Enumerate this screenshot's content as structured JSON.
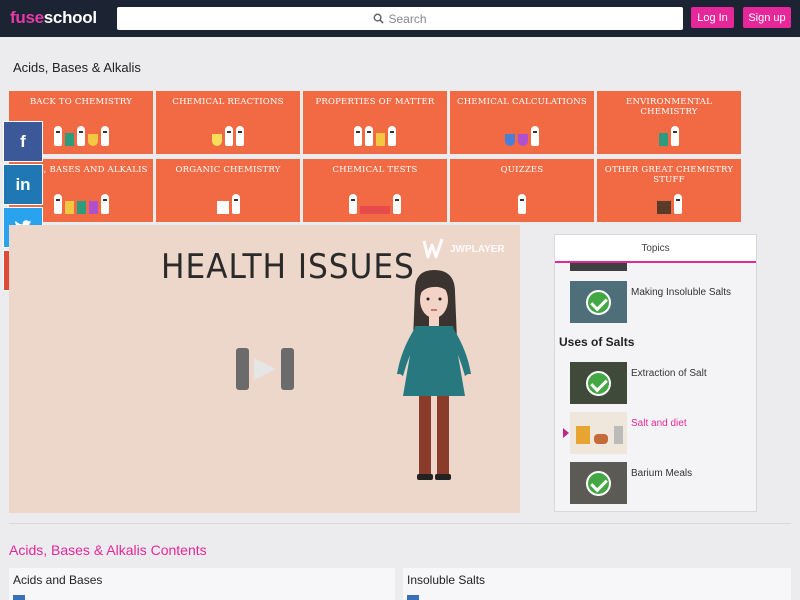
{
  "header": {
    "logo_part1": "fuse",
    "logo_part2": "school",
    "search_placeholder": "Search",
    "login_label": "Log In",
    "signup_label": "Sign up"
  },
  "page": {
    "title": "Acids, Bases & Alkalis"
  },
  "categories": [
    {
      "label": "Back to Chemistry"
    },
    {
      "label": "Chemical Reactions"
    },
    {
      "label": "Properties of Matter"
    },
    {
      "label": "Chemical Calculations"
    },
    {
      "label": "Environmental Chemistry"
    },
    {
      "label": "Acids, Bases and Alkalis"
    },
    {
      "label": "Organic Chemistry"
    },
    {
      "label": "Chemical Tests"
    },
    {
      "label": "Quizzes"
    },
    {
      "label": "Other Great Chemistry Stuff"
    }
  ],
  "social": {
    "facebook": "f",
    "linkedin": "in",
    "twitter": "t",
    "googleplus": "G+"
  },
  "video": {
    "title": "HEALTH ISSUES",
    "player_brand": "JWPLAYER"
  },
  "topics": {
    "tab_label": "Topics",
    "section": "Uses of Salts",
    "items": [
      {
        "label": "Making Insoluble Salts",
        "completed": true
      },
      {
        "label": "Extraction of Salt",
        "completed": true
      },
      {
        "label": "Salt and diet",
        "completed": false,
        "active": true
      },
      {
        "label": "Barium Meals",
        "completed": true
      }
    ]
  },
  "contents": {
    "title": "Acids, Bases & Alkalis Contents",
    "columns": [
      {
        "heading": "Acids and Bases"
      },
      {
        "heading": "Insoluble Salts"
      }
    ]
  },
  "colors": {
    "accent": "#e6279a",
    "tile": "#f26a44",
    "header_bg": "#1c2333"
  }
}
